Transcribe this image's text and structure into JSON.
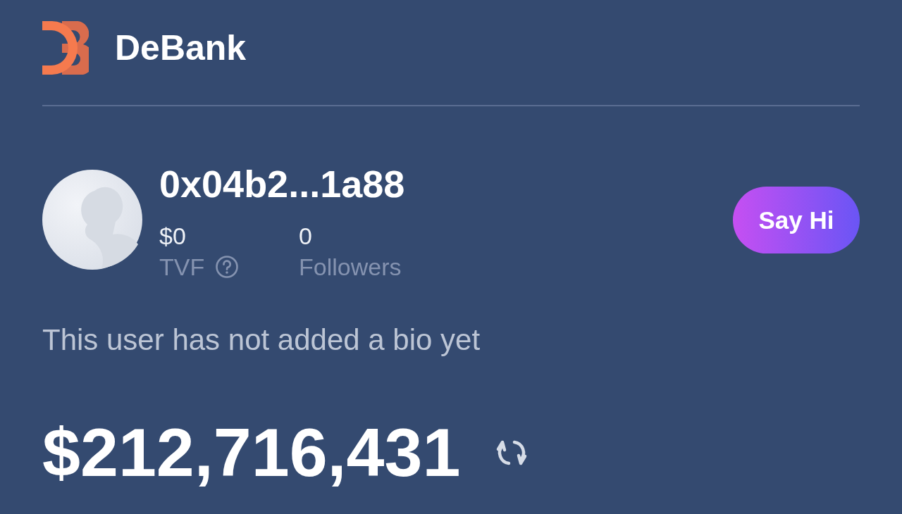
{
  "header": {
    "brand": "DeBank"
  },
  "profile": {
    "address": "0x04b2...1a88",
    "stats": [
      {
        "value": "$0",
        "label": "TVF",
        "help": true
      },
      {
        "value": "0",
        "label": "Followers",
        "help": false
      }
    ],
    "say_hi_button": "Say Hi",
    "bio": "This user has not added a bio yet"
  },
  "balance": {
    "amount": "$212,716,431"
  }
}
